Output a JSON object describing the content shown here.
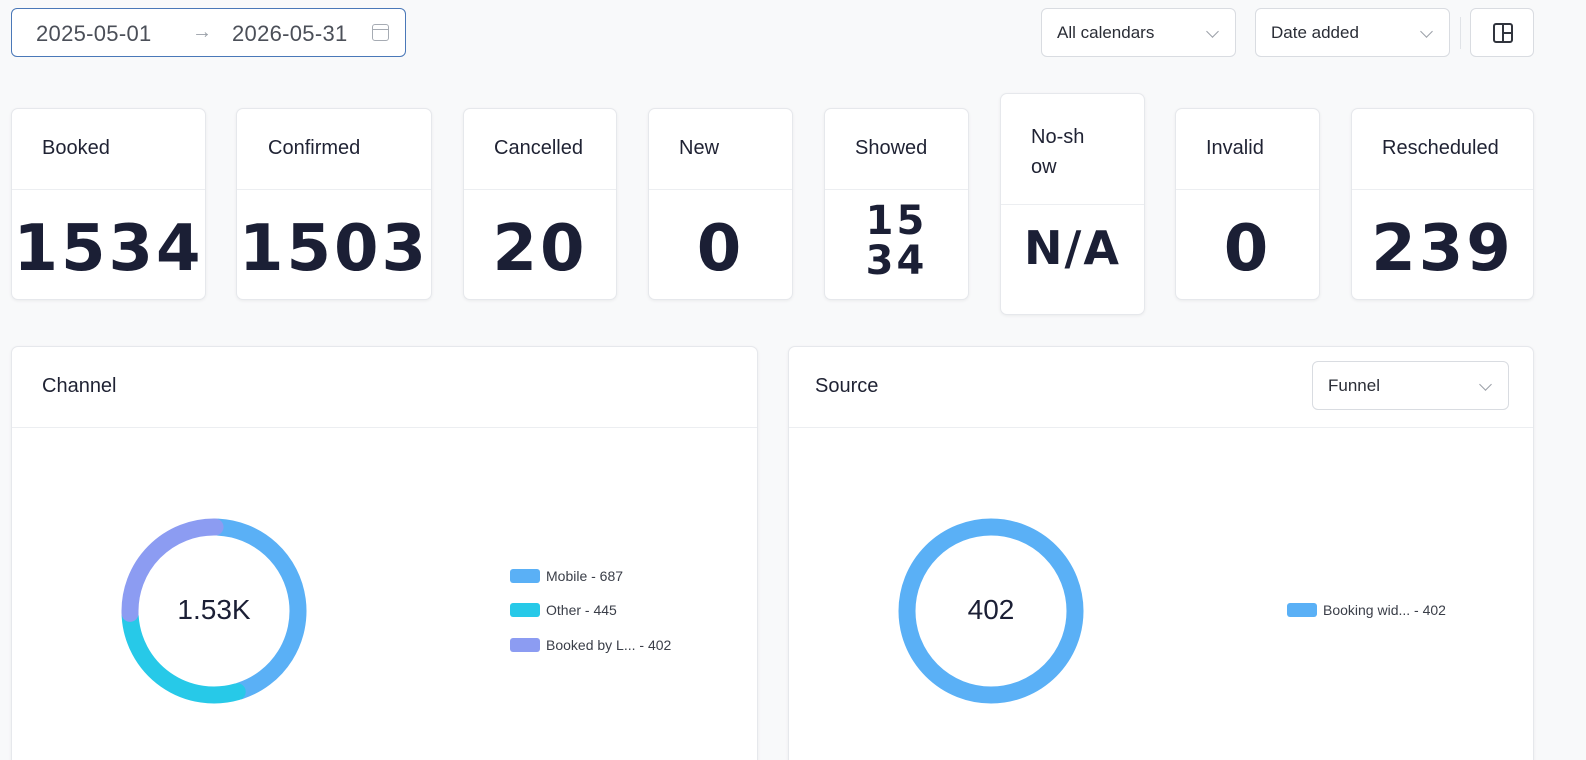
{
  "date_range": {
    "start": "2025-05-01",
    "arrow": "→",
    "end": "2026-05-31"
  },
  "filters": {
    "calendar": "All calendars",
    "sort": "Date added"
  },
  "stats": [
    {
      "label": "Booked",
      "value": "1534"
    },
    {
      "label": "Confirmed",
      "value": "1503"
    },
    {
      "label": "Cancelled",
      "value": "20"
    },
    {
      "label": "New",
      "value": "0"
    },
    {
      "label": "Showed",
      "value": "1534"
    },
    {
      "label": "No-show",
      "value": "N/A"
    },
    {
      "label": "Invalid",
      "value": "0"
    },
    {
      "label": "Rescheduled",
      "value": "239"
    }
  ],
  "channel": {
    "title": "Channel",
    "total_label": "1.53K",
    "items": [
      {
        "label": "Mobile - 687",
        "value": 687,
        "color": "#5ab0f6"
      },
      {
        "label": "Other - 445",
        "value": 445,
        "color": "#27c9e8"
      },
      {
        "label": "Booked by L... - 402",
        "value": 402,
        "color": "#8c9cf2"
      }
    ]
  },
  "source": {
    "title": "Source",
    "dropdown": "Funnel",
    "total_label": "402",
    "items": [
      {
        "label": "Booking wid... - 402",
        "value": 402,
        "color": "#5ab0f6"
      }
    ]
  }
}
